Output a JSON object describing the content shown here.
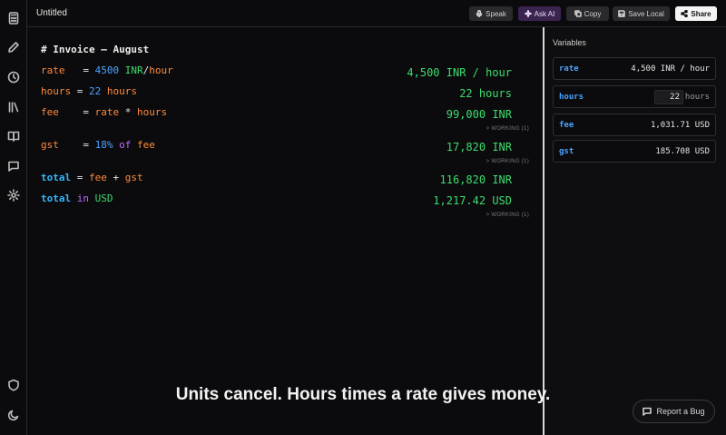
{
  "app": {
    "title": "Untitled"
  },
  "rail": {
    "icons": [
      "calculator-icon",
      "pencil-icon",
      "clock-icon",
      "library-icon",
      "book-icon",
      "chat-icon",
      "gear-icon",
      "shield-icon",
      "moon-icon"
    ]
  },
  "toolbar": {
    "speak_label": "Speak",
    "ask_label": "Ask AI",
    "copy_label": "Copy",
    "save_label": "Save Local",
    "share_label": "Share"
  },
  "editor": {
    "heading": "# Invoice — August",
    "lines": {
      "rate": {
        "name": "rate",
        "sp": "  ",
        "eq": " = ",
        "num": "4500",
        "unit1": " INR",
        "slash": "/",
        "unit2": "hour"
      },
      "hours": {
        "name": "hours",
        "eq": " = ",
        "num": "22",
        "unit": " hours"
      },
      "fee": {
        "name": "fee",
        "sp": "   ",
        "eq": " = ",
        "a": "rate",
        "op": " * ",
        "b": "hours"
      },
      "gst": {
        "name": "gst",
        "sp": "   ",
        "eq": " = ",
        "num": "18%",
        "kw": " of ",
        "b": "fee"
      },
      "total": {
        "name": "total",
        "eq": " = ",
        "a": "fee",
        "op": " + ",
        "b": "gst"
      },
      "total_usd": {
        "name": "total",
        "kw": " in ",
        "unit": "USD"
      }
    },
    "results": {
      "rate": "4,500 INR / hour",
      "hours": "22 hours",
      "fee": "99,000 INR",
      "gst": "17,820 INR",
      "total": "116,820 INR",
      "total_usd": "1,217.42 USD"
    },
    "working_label": "> WORKING (1)"
  },
  "variables": {
    "title": "Variables",
    "items": [
      {
        "name": "rate",
        "value": "4,500 INR / hour"
      },
      {
        "name": "hours",
        "value": "22",
        "unit": "hours"
      },
      {
        "name": "fee",
        "value": "1,031.71 USD"
      },
      {
        "name": "gst",
        "value": "185.708 USD"
      }
    ]
  },
  "caption": "Units cancel. Hours times a rate gives money.",
  "report_bug_label": "Report a Bug"
}
